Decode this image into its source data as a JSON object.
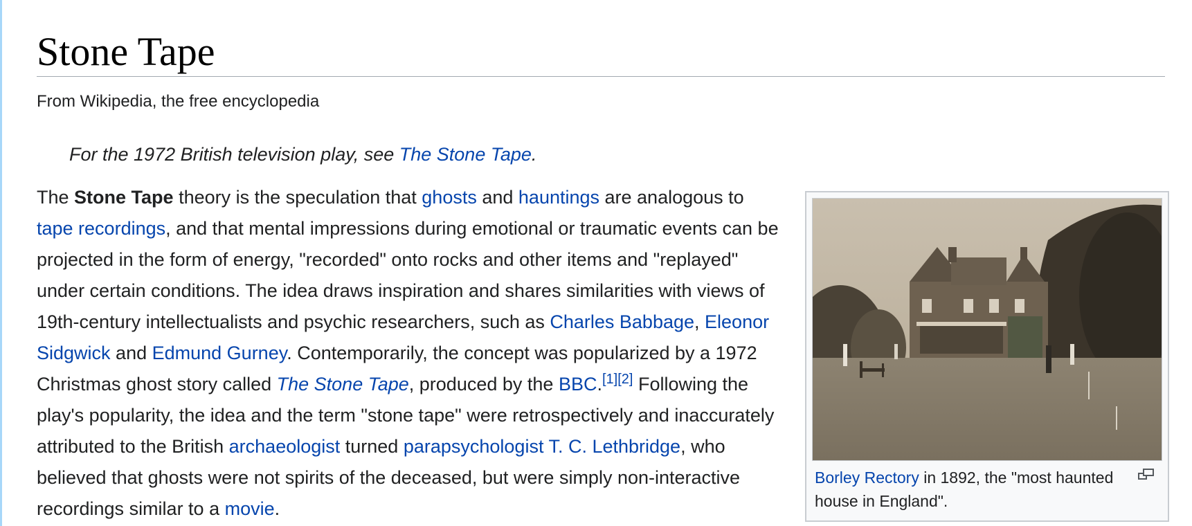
{
  "article": {
    "title": "Stone Tape",
    "tagline": "From Wikipedia, the free encyclopedia"
  },
  "hatnote": {
    "prefix": "For the 1972 British television play, see ",
    "link": "The Stone Tape",
    "suffix": "."
  },
  "paragraph": {
    "t1": "The ",
    "bold": "Stone Tape",
    "t2": " theory is the speculation that ",
    "l_ghosts": "ghosts",
    "t3": " and ",
    "l_hauntings": "hauntings",
    "t4": " are analogous to ",
    "l_tape": "tape recordings",
    "t5": ", and that mental impressions during emotional or traumatic events can be projected in the form of energy, \"recorded\" onto rocks and other items and \"replayed\" under certain conditions. The idea draws inspiration and shares similarities with views of 19th-century intellectualists and psychic researchers, such as ",
    "l_babbage": "Charles Babbage",
    "t6": ", ",
    "l_sidgwick": "Eleonor Sidgwick",
    "t7": " and ",
    "l_gurney": "Edmund Gurney",
    "t8": ". Contemporarily, the concept was popularized by a 1972 Christmas ghost story called ",
    "l_stonetape": "The Stone Tape",
    "t9": ", produced by the ",
    "l_bbc": "BBC",
    "t10": ".",
    "ref1": "[1]",
    "ref2": "[2]",
    "t11": " Following the play's popularity, the idea and the term \"stone tape\" were retrospectively and inaccurately attributed to the British ",
    "l_archaeologist": "archaeologist",
    "t12": " turned ",
    "l_parapsychologist": "parapsychologist",
    "t13": " ",
    "l_lethbridge": "T. C. Lethbridge",
    "t14": ", who believed that ghosts were not spirits of the deceased, but were simply non-interactive recordings similar to a ",
    "l_movie": "movie",
    "t15": "."
  },
  "infobox": {
    "caption_link": "Borley Rectory",
    "caption_text": " in 1892, the \"most haunted house in England\".",
    "enlarge_icon": "magnify-icon"
  },
  "colors": {
    "link": "#0645ad",
    "text": "#202122",
    "rule": "#a2a9b1",
    "sidebar_border": "#a7d7f9"
  }
}
